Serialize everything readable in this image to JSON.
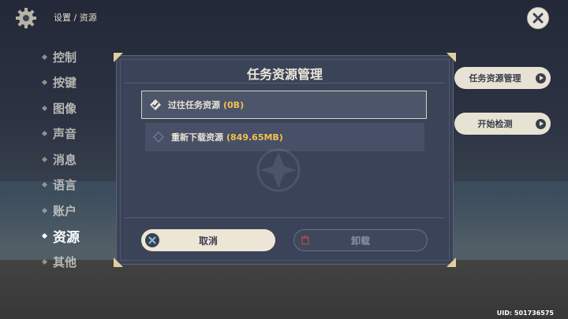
{
  "breadcrumb": "设置 / 资源",
  "menu": {
    "items": [
      {
        "label": "控制"
      },
      {
        "label": "按键"
      },
      {
        "label": "图像"
      },
      {
        "label": "声音"
      },
      {
        "label": "消息"
      },
      {
        "label": "语言"
      },
      {
        "label": "账户"
      },
      {
        "label": "资源"
      },
      {
        "label": "其他"
      }
    ],
    "active_index": 7
  },
  "side_buttons": {
    "manage_label": "任务资源管理",
    "check_label": "开始检测"
  },
  "modal": {
    "title": "任务资源管理",
    "options": [
      {
        "label": "过往任务资源",
        "size": "(0B)",
        "checked": true
      },
      {
        "label": "重新下载资源",
        "size": "(849.65MB)",
        "checked": false
      }
    ],
    "cancel_label": "取消",
    "uninstall_label": "卸载"
  },
  "uid": "UID: 501736575",
  "colors": {
    "accent_gold": "#f2c14e",
    "panel_bg": "#3b4358",
    "button_light": "#ede6d6"
  }
}
